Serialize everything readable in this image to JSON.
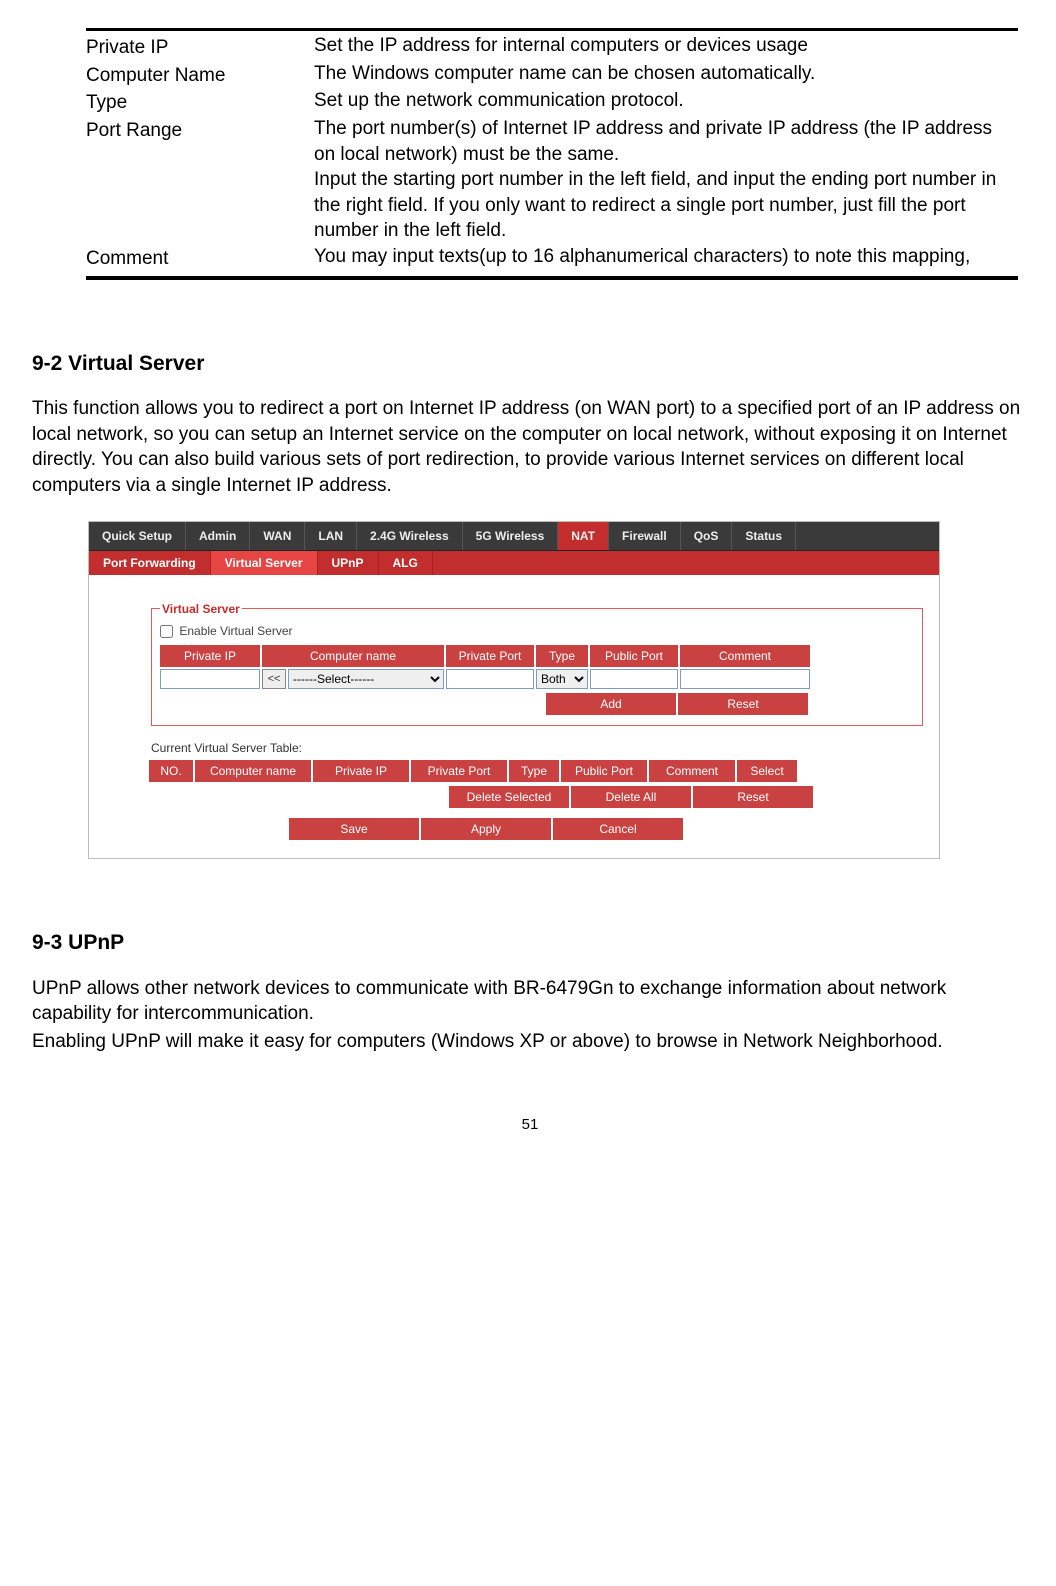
{
  "definitions": [
    {
      "term": "Private IP",
      "desc": "Set the IP address for internal computers or devices usage"
    },
    {
      "term": "Computer Name",
      "desc": "The Windows computer name can be chosen automatically."
    },
    {
      "term": "Type",
      "desc": "Set up the network communication protocol."
    },
    {
      "term": "Port Range",
      "desc": "The port number(s) of Internet IP address and private IP address (the IP address on local network) must be the same.\nInput the starting port number in the left field, and input the ending port number in the right field. If you only want to redirect a single port number, just fill the port number in the left field."
    },
    {
      "term": "Comment",
      "desc": "You may input texts(up to 16 alphanumerical characters) to note this mapping,"
    }
  ],
  "section_virtual_server": {
    "heading": "9-2 Virtual Server",
    "paragraph": "This function allows you to redirect a port on Internet IP address (on WAN port) to a specified port of an IP address on local network, so you can setup an Internet service on the computer on local network, without exposing it on Internet directly. You can also build various sets of port redirection, to provide various Internet services on different local computers via a single Internet IP address."
  },
  "router_ui": {
    "main_tabs": [
      "Quick Setup",
      "Admin",
      "WAN",
      "LAN",
      "2.4G Wireless",
      "5G Wireless",
      "NAT",
      "Firewall",
      "QoS",
      "Status"
    ],
    "main_active": "NAT",
    "sub_tabs": [
      "Port Forwarding",
      "Virtual Server",
      "UPnP",
      "ALG"
    ],
    "sub_active": "Virtual Server",
    "fieldset_legend": "Virtual Server",
    "enable_label": "Enable Virtual Server",
    "form_headers": {
      "private_ip": "Private IP",
      "computer_name": "Computer name",
      "private_port": "Private Port",
      "type": "Type",
      "public_port": "Public Port",
      "comment": "Comment"
    },
    "arrow_label": "<<",
    "select_placeholder": "------Select------",
    "type_value": "Both",
    "buttons": {
      "add": "Add",
      "reset": "Reset",
      "delete_selected": "Delete Selected",
      "delete_all": "Delete All",
      "reset2": "Reset",
      "save": "Save",
      "apply": "Apply",
      "cancel": "Cancel"
    },
    "table_caption": "Current Virtual Server Table:",
    "table_headers": {
      "no": "NO.",
      "computer_name": "Computer name",
      "private_ip": "Private IP",
      "private_port": "Private Port",
      "type": "Type",
      "public_port": "Public Port",
      "comment": "Comment",
      "select": "Select"
    }
  },
  "section_upnp": {
    "heading": "9-3 UPnP",
    "p1": "UPnP allows other network devices to communicate with BR-6479Gn to exchange information about network capability for intercommunication.",
    "p2": "Enabling UPnP will make it easy for computers (Windows XP or above) to browse in Network Neighborhood."
  },
  "page_number": "51"
}
